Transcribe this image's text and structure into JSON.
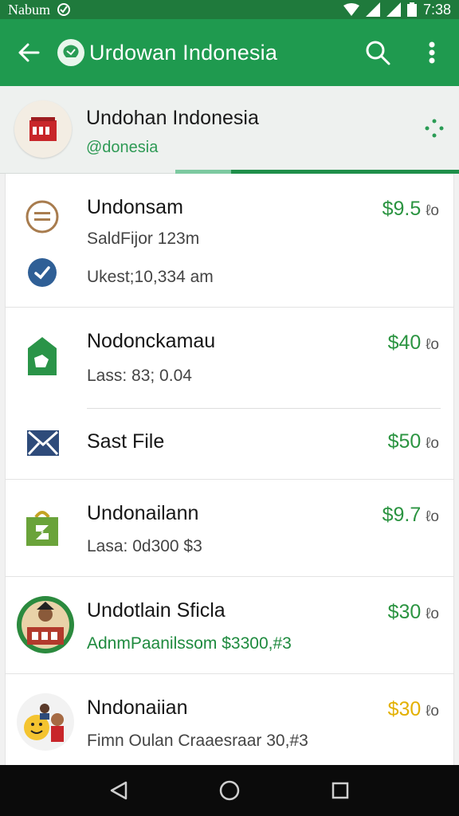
{
  "status_bar": {
    "carrier": "Nabum",
    "time": "7:38"
  },
  "app_bar": {
    "title": "Urdowan Indonesia"
  },
  "profile": {
    "name": "Undohan Indonesia",
    "handle": "@donesia"
  },
  "items": [
    {
      "title": "Undonsam",
      "sub1": "SaldFijor 123m",
      "sub2": "Ukest;10,334 am",
      "price": "$9.5",
      "unit": "ℓo"
    },
    {
      "title": "Nodonckamau",
      "sub1": "Lass: 83; 0.04",
      "price": "$40",
      "unit": "ℓo"
    },
    {
      "title": "Sast File",
      "price": "$50",
      "unit": "ℓo"
    },
    {
      "title": "Undonailann",
      "sub1": "Lasa: 0d300 $3",
      "price": "$9.7",
      "unit": "ℓo"
    },
    {
      "title": "Undotlain Sficla",
      "sub1": "AdnmPaanilssom $3300,#3",
      "price": "$30",
      "unit": "ℓo"
    },
    {
      "title": "Nndonaiian",
      "sub1": "Fimn Oulan Craaesraar 30,#3",
      "price": "$30",
      "unit": "ℓo"
    }
  ],
  "colors": {
    "primary": "#1f9a4f",
    "status": "#1f7a3c",
    "price_green": "#2b9441",
    "price_gold": "#e3b000"
  }
}
